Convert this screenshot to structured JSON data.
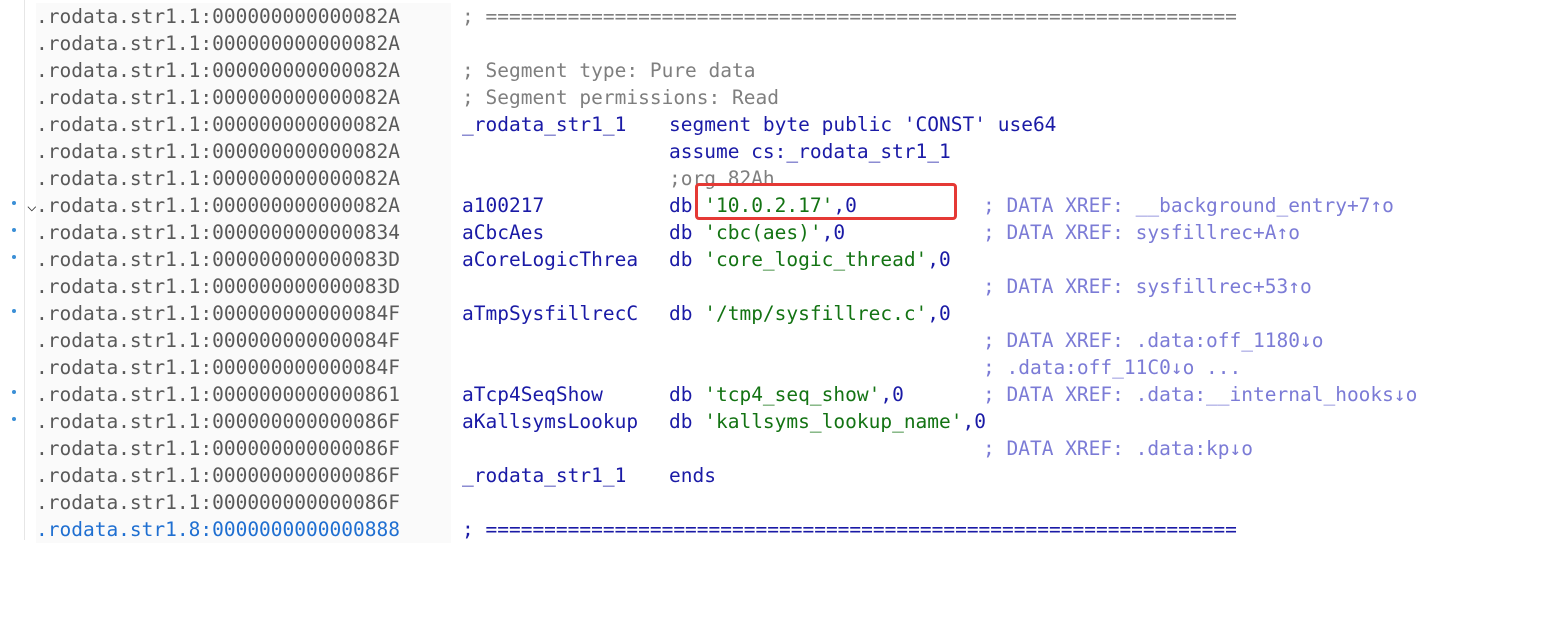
{
  "lines": [
    {
      "addr": ".rodata.str1.1:000000000000082A",
      "label": "",
      "dir": "",
      "comment": "; ================================================================",
      "xref": ""
    },
    {
      "addr": ".rodata.str1.1:000000000000082A",
      "label": "",
      "dir": "",
      "comment": "",
      "xref": ""
    },
    {
      "addr": ".rodata.str1.1:000000000000082A",
      "label": "",
      "dir": "",
      "comment": "; Segment type: Pure data",
      "xref": ""
    },
    {
      "addr": ".rodata.str1.1:000000000000082A",
      "label": "",
      "dir": "",
      "comment": "; Segment permissions: Read",
      "xref": ""
    },
    {
      "addr": ".rodata.str1.1:000000000000082A",
      "label": "_rodata_str1_1",
      "dir": "segment byte public 'CONST' use64",
      "comment": "",
      "xref": ""
    },
    {
      "addr": ".rodata.str1.1:000000000000082A",
      "label": "",
      "dir": "assume cs:_rodata_str1_1",
      "comment": "",
      "xref": ""
    },
    {
      "addr": ".rodata.str1.1:000000000000082A",
      "label": "",
      "dir": ";org 82Ah",
      "comment": "",
      "xref": ""
    },
    {
      "addr": ".rodata.str1.1:000000000000082A",
      "label": "a100217",
      "db": "db",
      "str": "'10.0.2.17'",
      "tail": ",0",
      "xref": "; DATA XREF: __background_entry+7↑o"
    },
    {
      "addr": ".rodata.str1.1:0000000000000834",
      "label": "aCbcAes",
      "db": "db",
      "str": "'cbc(aes)'",
      "tail": ",0",
      "xref": "; DATA XREF: sysfillrec+A↑o"
    },
    {
      "addr": ".rodata.str1.1:000000000000083D",
      "label": "aCoreLogicThrea",
      "db": "db",
      "str": "'core_logic_thread'",
      "tail": ",0",
      "xref": ""
    },
    {
      "addr": ".rodata.str1.1:000000000000083D",
      "label": "",
      "xref": "; DATA XREF: sysfillrec+53↑o"
    },
    {
      "addr": ".rodata.str1.1:000000000000084F",
      "label": "aTmpSysfillrecC",
      "db": "db",
      "str": "'/tmp/sysfillrec.c'",
      "tail": ",0",
      "xref": ""
    },
    {
      "addr": ".rodata.str1.1:000000000000084F",
      "label": "",
      "xref": "; DATA XREF: .data:off_1180↓o"
    },
    {
      "addr": ".rodata.str1.1:000000000000084F",
      "label": "",
      "xref": "; .data:off_11C0↓o ..."
    },
    {
      "addr": ".rodata.str1.1:0000000000000861",
      "label": "aTcp4SeqShow",
      "db": "db",
      "str": "'tcp4_seq_show'",
      "tail": ",0",
      "xref": "; DATA XREF: .data:__internal_hooks↓o"
    },
    {
      "addr": ".rodata.str1.1:000000000000086F",
      "label": "aKallsymsLookup",
      "db": "db",
      "str": "'kallsyms_lookup_name'",
      "tail": ",0",
      "xref": ""
    },
    {
      "addr": ".rodata.str1.1:000000000000086F",
      "label": "",
      "xref": "; DATA XREF: .data:kp↓o"
    },
    {
      "addr": ".rodata.str1.1:000000000000086F",
      "label": "_rodata_str1_1",
      "dir": "ends",
      "xref": ""
    },
    {
      "addr": ".rodata.str1.1:000000000000086F",
      "label": "",
      "xref": ""
    },
    {
      "addr": ".rodata.str1.8:0000000000000888",
      "label": "",
      "comment": "; ================================================================",
      "xref": ""
    }
  ],
  "colors": {
    "address": "#595959",
    "address_next_segment": "#1f6fd1",
    "label": "#1a1aa6",
    "string": "#137313",
    "comment": "#7f7f7f",
    "xref": "#7b7bd6",
    "highlight_border": "#e53935"
  }
}
